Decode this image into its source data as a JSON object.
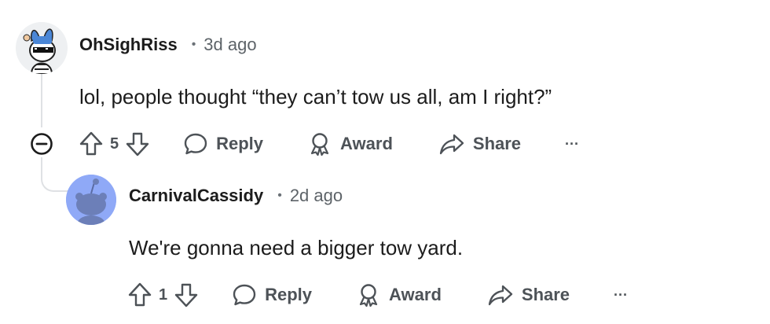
{
  "comment": {
    "username": "OhSighRiss",
    "separator": "•",
    "time": "3d ago",
    "body": "lol, people thought “they can’t tow us all, am I right?”",
    "votes": "5",
    "reply_label": "Reply",
    "award_label": "Award",
    "share_label": "Share",
    "more_label": "···"
  },
  "reply": {
    "username": "CarnivalCassidy",
    "separator": "•",
    "time": "2d ago",
    "body": "We're gonna need a bigger tow yard.",
    "votes": "1",
    "reply_label": "Reply",
    "award_label": "Award",
    "share_label": "Share",
    "more_label": "···"
  },
  "icons": {
    "collapse": "minus-circle-icon",
    "upvote": "arrow-up-icon",
    "downvote": "arrow-down-icon",
    "reply": "speech-bubble-icon",
    "award": "award-ribbon-icon",
    "share": "share-arrow-icon"
  },
  "colors": {
    "text": "#1c1c1c",
    "meta": "#5d6368",
    "action": "#4d5257",
    "thread_line": "#dfe1e4",
    "avatar2_bg": "#8fa9f7"
  }
}
